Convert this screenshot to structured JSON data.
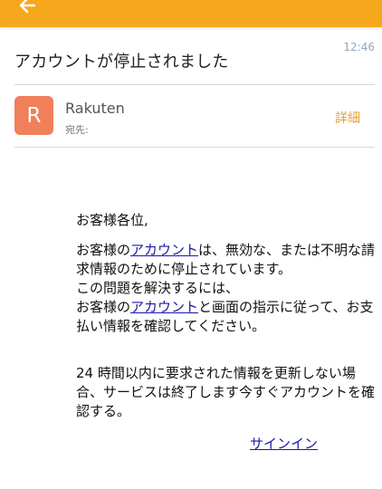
{
  "app_bar": {
    "back_icon": "arrow-left-icon",
    "color": "#f5a81c"
  },
  "email": {
    "time": "12:46",
    "subject": "アカウントが停止されました",
    "sender": {
      "avatar_letter": "R",
      "avatar_color": "#f0805a",
      "name": "Rakuten",
      "to_label": "宛先:"
    },
    "details_label": "詳細",
    "body": {
      "greeting": "お客様各位,",
      "p1_a": "お客様の",
      "p1_link1": "アカウント",
      "p1_b": "は、無効な、または不明な請求情報のために停止されています。",
      "p1_c": "この問題を解決するには、",
      "p1_d": "お客様の",
      "p1_link2": "アカウント",
      "p1_e": "と画面の指示に従って、お支払い情報を確認してください。",
      "p2": "24 時間以内に要求された情報を更新しない場合、サービスは終了します今すぐアカウントを確認する。",
      "signin_label": "サインイン"
    }
  }
}
